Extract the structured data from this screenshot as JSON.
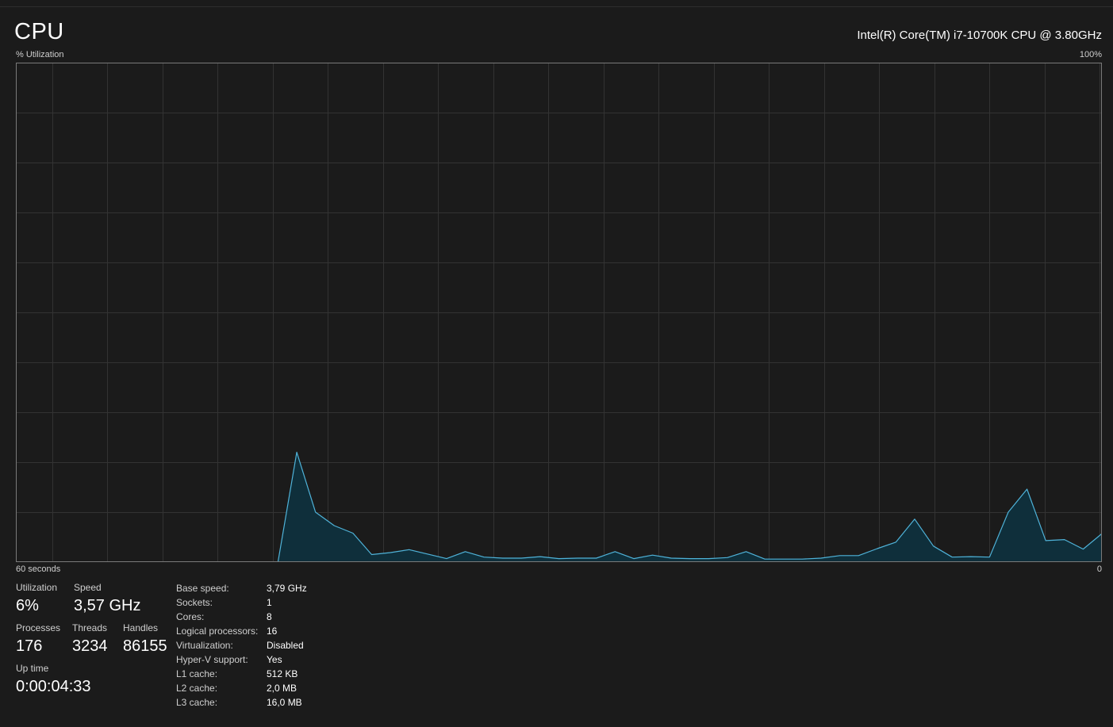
{
  "header": {
    "title": "CPU",
    "cpu_name": "Intel(R) Core(TM) i7-10700K CPU @ 3.80GHz",
    "y_label": "% Utilization",
    "y_max_label": "100%"
  },
  "graph": {
    "x_label": "60 seconds",
    "y_min_label": "0",
    "line_color": "#4fb3d9",
    "fill_color": "#0f2f3b",
    "grid_color": "#333333",
    "border_color": "#7a7a7a"
  },
  "chart_data": {
    "type": "area",
    "title": "",
    "xlabel": "60 seconds",
    "ylabel": "% Utilization",
    "ylim": [
      0,
      100
    ],
    "xlim": [
      0,
      60
    ],
    "grid": true,
    "series": [
      {
        "values": [
          0,
          0,
          0,
          0,
          0,
          0,
          0,
          0,
          0,
          0,
          0,
          0,
          0,
          0,
          0,
          22,
          10,
          7.3,
          5.8,
          1.5,
          1.9,
          2.5,
          1.6,
          0.7,
          2.1,
          1,
          0.8,
          0.8,
          1.1,
          0.7,
          0.8,
          0.8,
          2.1,
          0.7,
          1.4,
          0.8,
          0.7,
          0.7,
          0.9,
          2.1,
          0.6,
          0.6,
          0.6,
          0.8,
          1.3,
          1.3,
          2.7,
          4,
          8.6,
          3.2,
          1,
          1.1,
          1,
          10,
          14.6,
          4.3,
          4.5,
          2.6,
          5.7
        ]
      }
    ]
  },
  "stats": {
    "utilization": {
      "label": "Utilization",
      "value": "6%"
    },
    "speed": {
      "label": "Speed",
      "value": "3,57 GHz"
    },
    "processes": {
      "label": "Processes",
      "value": "176"
    },
    "threads": {
      "label": "Threads",
      "value": "3234"
    },
    "handles": {
      "label": "Handles",
      "value": "86155"
    },
    "uptime": {
      "label": "Up time",
      "value": "0:00:04:33"
    }
  },
  "specs": [
    {
      "key": "Base speed:",
      "value": "3,79 GHz"
    },
    {
      "key": "Sockets:",
      "value": "1"
    },
    {
      "key": "Cores:",
      "value": "8"
    },
    {
      "key": "Logical processors:",
      "value": "16"
    },
    {
      "key": "Virtualization:",
      "value": "Disabled"
    },
    {
      "key": "Hyper-V support:",
      "value": "Yes"
    },
    {
      "key": "L1 cache:",
      "value": "512 KB"
    },
    {
      "key": "L2 cache:",
      "value": "2,0 MB"
    },
    {
      "key": "L3 cache:",
      "value": "16,0 MB"
    }
  ]
}
